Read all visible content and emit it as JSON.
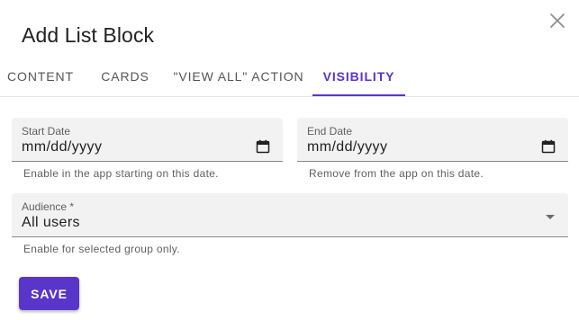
{
  "dialog": {
    "title": "Add List Block",
    "close_icon": "close-icon"
  },
  "tabs": [
    {
      "label": "CONTENT",
      "active": false
    },
    {
      "label": "CARDS",
      "active": false
    },
    {
      "label": "\"VIEW ALL\" ACTION",
      "active": false
    },
    {
      "label": "VISIBILITY",
      "active": true
    }
  ],
  "form": {
    "start_date": {
      "label": "Start Date",
      "value": "mm/dd/yyyy",
      "helper": "Enable in the app starting on this date.",
      "icon": "calendar-icon"
    },
    "end_date": {
      "label": "End Date",
      "value": "mm/dd/yyyy",
      "helper": "Remove from the app on this date.",
      "icon": "calendar-icon"
    },
    "audience": {
      "label": "Audience *",
      "value": "All users",
      "helper": "Enable for selected group only.",
      "icon": "dropdown-arrow-icon"
    }
  },
  "actions": {
    "save_label": "SAVE"
  },
  "colors": {
    "accent": "#5a35c9",
    "field_background": "#f2f2f2"
  }
}
